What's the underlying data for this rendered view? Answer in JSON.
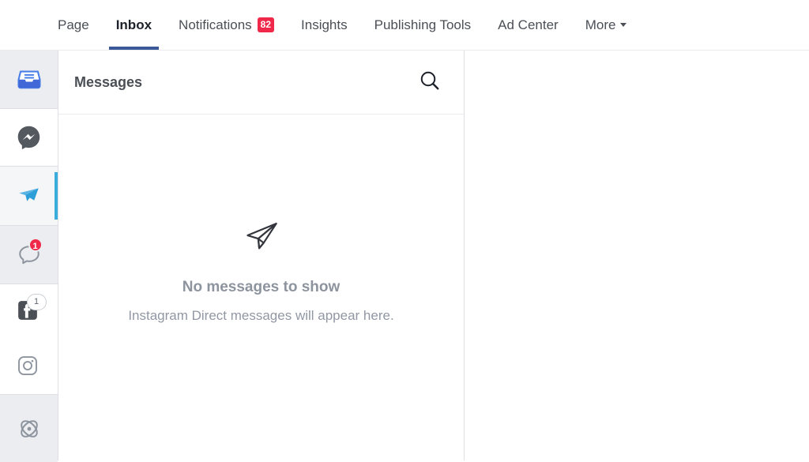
{
  "topnav": {
    "items": [
      {
        "label": "Page",
        "active": false,
        "badge": null,
        "caret": false
      },
      {
        "label": "Inbox",
        "active": true,
        "badge": null,
        "caret": false
      },
      {
        "label": "Notifications",
        "active": false,
        "badge": "82",
        "caret": false
      },
      {
        "label": "Insights",
        "active": false,
        "badge": null,
        "caret": false
      },
      {
        "label": "Publishing Tools",
        "active": false,
        "badge": null,
        "caret": false
      },
      {
        "label": "Ad Center",
        "active": false,
        "badge": null,
        "caret": false
      },
      {
        "label": "More",
        "active": false,
        "badge": null,
        "caret": true
      }
    ],
    "active_underline_color": "#3b5998",
    "badge_color": "#f02849"
  },
  "sidebar": {
    "active_indicator_color": "#3aaddd",
    "items": [
      {
        "name": "inbox",
        "icon": "inbox-tray-icon",
        "badge": null,
        "selected": false,
        "background": "shaded"
      },
      {
        "name": "messenger",
        "icon": "messenger-icon",
        "badge": null,
        "selected": false,
        "background": "plain"
      },
      {
        "name": "instagram-direct",
        "icon": "paper-plane-icon",
        "badge": null,
        "selected": true,
        "background": "subtle"
      },
      {
        "name": "comments",
        "icon": "comment-bubble-icon",
        "badge": "1",
        "selected": false,
        "background": "shaded"
      },
      {
        "name": "facebook",
        "icon": "facebook-icon",
        "badge": "1",
        "selected": false,
        "background": "plain"
      },
      {
        "name": "instagram",
        "icon": "instagram-icon",
        "badge": null,
        "selected": false,
        "background": "plain"
      },
      {
        "name": "automation",
        "icon": "atom-icon",
        "badge": null,
        "selected": false,
        "background": "shaded"
      }
    ]
  },
  "messages_panel": {
    "title": "Messages",
    "search_icon": "search-icon",
    "empty_state": {
      "icon": "paper-plane-outline-icon",
      "title": "No messages to show",
      "subtitle": "Instagram Direct messages will appear here."
    }
  }
}
